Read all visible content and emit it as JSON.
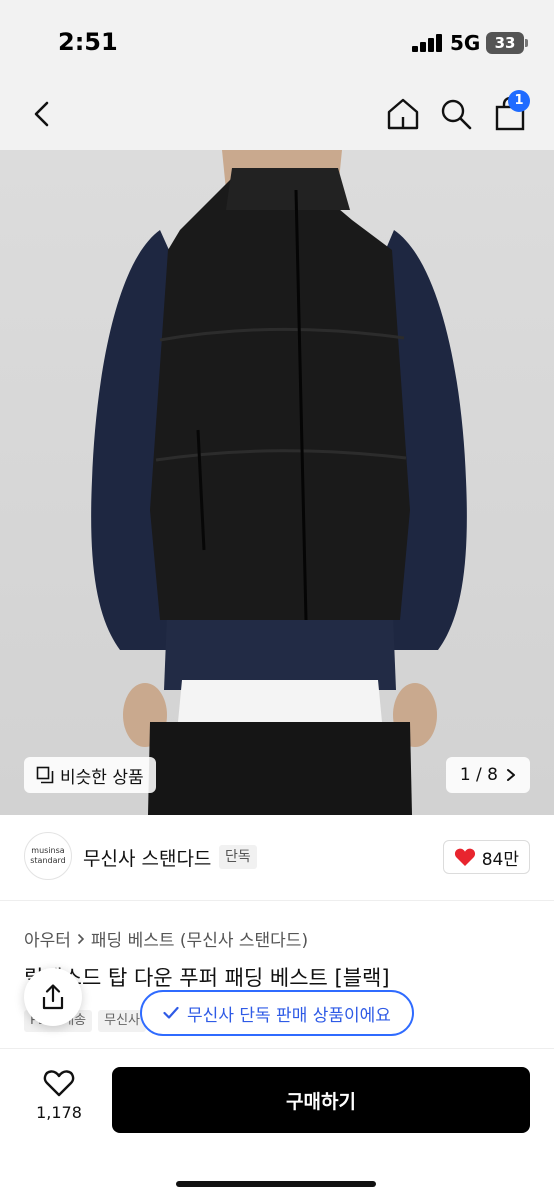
{
  "status": {
    "time": "2:51",
    "network": "5G",
    "battery": "33"
  },
  "nav": {
    "cart_count": "1"
  },
  "image": {
    "similar_label": "비슷한 상품",
    "counter": "1 / 8"
  },
  "brand": {
    "logo_line1": "musinsa",
    "logo_line2": "standard",
    "name": "무신사 스탠다드",
    "tag": "단독",
    "likes": "84만"
  },
  "breadcrumb": {
    "category": "아우터",
    "subcategory": "패딩 베스트 (무신사 스탠다드)"
  },
  "product": {
    "title": "릴렉스드 탑 다운 푸퍼 패딩 베스트 [블랙]",
    "tags": [
      "PLUS배송",
      "무신사"
    ]
  },
  "toast": {
    "text": "무신사 단독 판매 상품이에요"
  },
  "bottom": {
    "wish_count": "1,178",
    "buy_label": "구매하기"
  },
  "colors": {
    "accent": "#2f6bff",
    "heart": "#e8252e",
    "buy_button": "#000000"
  }
}
